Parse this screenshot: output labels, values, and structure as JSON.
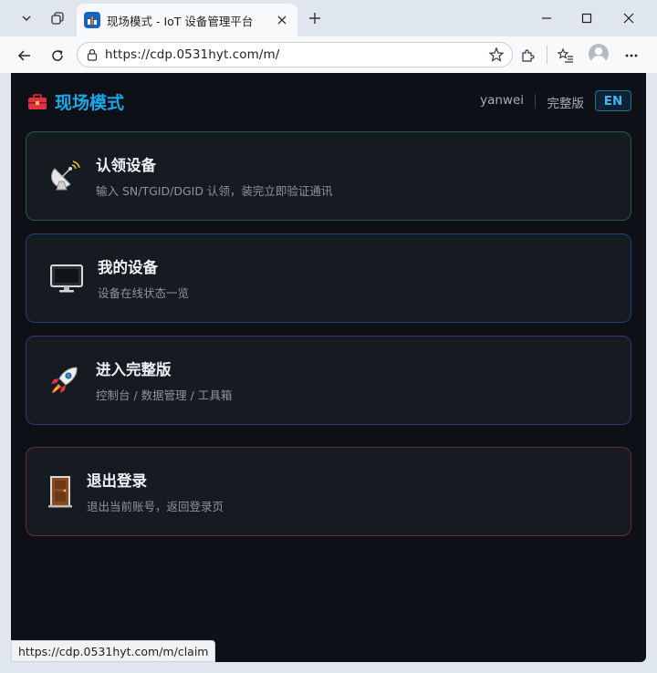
{
  "browser": {
    "tab_title": "现场模式 - IoT 设备管理平台",
    "url": "https://cdp.0531hyt.com/m/",
    "status_url": "https://cdp.0531hyt.com/m/claim"
  },
  "app": {
    "title": "现场模式",
    "username": "yanwei",
    "full_version_link": "完整版",
    "lang_button": "EN"
  },
  "cards": [
    {
      "title": "认领设备",
      "subtitle": "输入 SN/TGID/DGID 认领，装完立即验证通讯",
      "icon": "satellite-dish-icon",
      "border": "#2a5a36"
    },
    {
      "title": "我的设备",
      "subtitle": "设备在线状态一览",
      "icon": "monitor-icon",
      "border": "#243f78"
    },
    {
      "title": "进入完整版",
      "subtitle": "控制台 / 数据管理 / 工具箱",
      "icon": "rocket-icon",
      "border": "#3a3570"
    },
    {
      "title": "退出登录",
      "subtitle": "退出当前账号，返回登录页",
      "icon": "door-icon",
      "border": "#6a2a2e"
    }
  ]
}
